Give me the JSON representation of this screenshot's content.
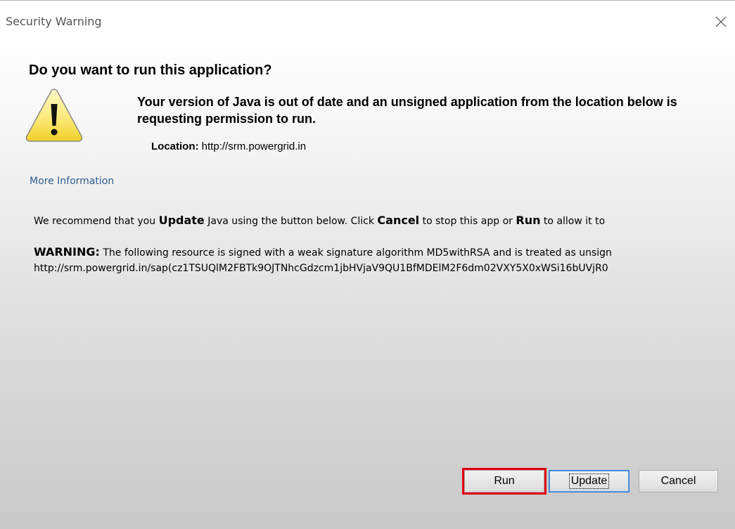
{
  "window": {
    "title": "Security Warning"
  },
  "dialog": {
    "heading": "Do you want to run this application?",
    "description": "Your version of Java is out of date and an unsigned application from the location below is requesting permission to run.",
    "location_label": "Location:",
    "location_value": "http://srm.powergrid.in",
    "more_info_link": "More Information"
  },
  "recommendation": {
    "part1": "We recommend that you ",
    "update_word": "Update",
    "part2": " Java using the button below. Click ",
    "cancel_word": "Cancel",
    "part3": " to stop this app or ",
    "run_word": "Run",
    "part4": " to allow it to"
  },
  "warning": {
    "label": "WARNING:",
    "text": " The following resource is signed with a weak signature algorithm MD5withRSA and is treated as unsign",
    "url": "http://srm.powergrid.in/sap(cz1TSUQlM2FBTk9OJTNhcGdzcm1jbHVjaV9QU1BfMDElM2F6dm02VXY5X0xWSi16bUVjR0"
  },
  "buttons": {
    "run": "Run",
    "update": "Update",
    "cancel": "Cancel"
  },
  "icons": {
    "warning": "warning-triangle-icon",
    "close": "close-icon"
  },
  "colors": {
    "highlight": "#e0000f",
    "link": "#2f5f8f",
    "focus": "#2f7bd6"
  }
}
